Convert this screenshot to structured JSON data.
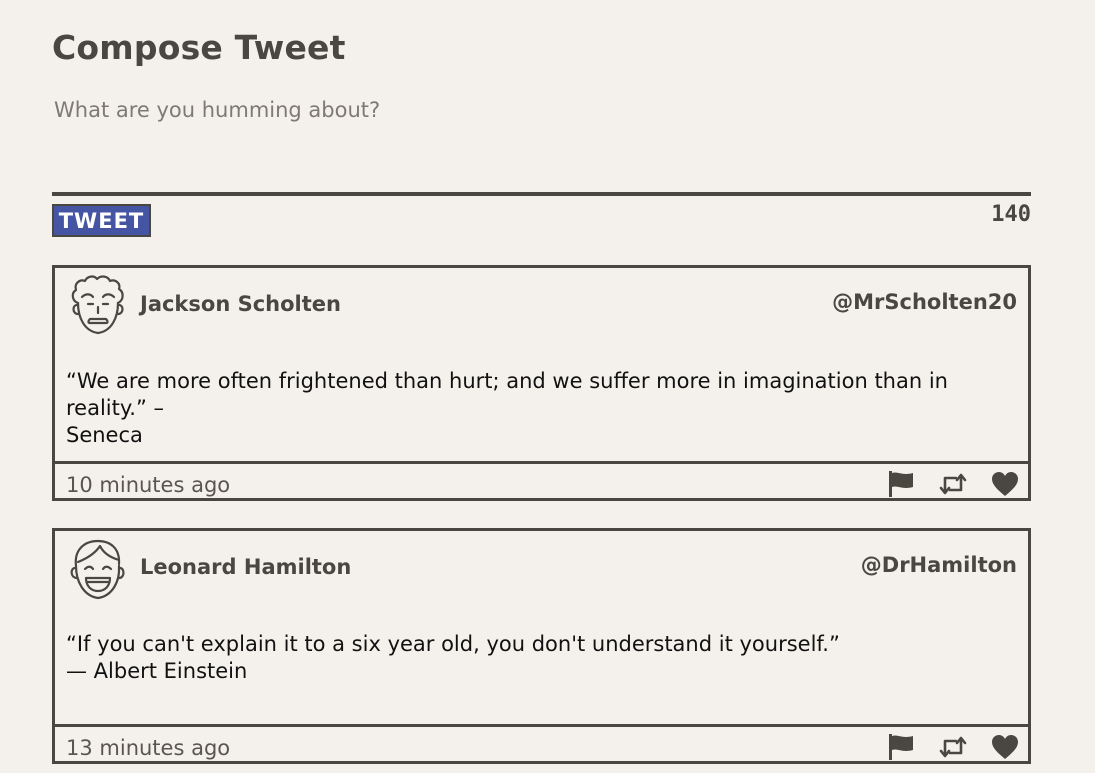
{
  "compose": {
    "title": "Compose Tweet",
    "placeholder": "What are you humming about?",
    "button_label": "TWEET",
    "char_count": "140"
  },
  "tweets": [
    {
      "name": "Jackson Scholten",
      "handle": "@MrScholten20",
      "text": "“We are more often frightened than hurt; and we suffer more in imagination than in reality.” –\nSeneca",
      "time": "10 minutes ago",
      "avatar_icon": "curly-hair-avatar-icon"
    },
    {
      "name": "Leonard Hamilton",
      "handle": "@DrHamilton",
      "text": "“If you can't explain it to a six year old, you don't understand it yourself.”\n— Albert Einstein",
      "time": "13 minutes ago",
      "avatar_icon": "laughing-avatar-icon"
    }
  ],
  "icons": [
    "flag-icon",
    "retweet-icon",
    "heart-icon"
  ],
  "colors": {
    "background": "#f4f1ec",
    "text": "#4a4640",
    "accent": "#4655a3"
  }
}
